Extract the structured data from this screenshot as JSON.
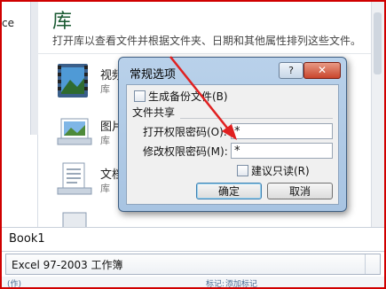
{
  "left_pane": {
    "cut_text": "ce"
  },
  "library": {
    "title": "库",
    "subtitle": "打开库以查看文件并根据文件夹、日期和其他属性排列这些文件。",
    "items": [
      {
        "name": "视频",
        "type": "库",
        "icon": "video-library-icon"
      },
      {
        "name": "图片",
        "type": "库",
        "icon": "picture-library-icon"
      },
      {
        "name": "文档",
        "type": "库",
        "icon": "document-library-icon"
      }
    ]
  },
  "filename": {
    "value": "Book1"
  },
  "filetype": {
    "value": "Excel 97-2003 工作簿"
  },
  "statusbar": {
    "left": "(作)",
    "right_a": "标记:",
    "right_b": "添加标记"
  },
  "dialog": {
    "title": "常规选项",
    "help_label": "?",
    "close_label": "✕",
    "backup_label": "生成备份文件(B)",
    "backup_checked": false,
    "group_label": "文件共享",
    "open_pw_label": "打开权限密码(O):",
    "open_pw_value": "*",
    "modify_pw_label": "修改权限密码(M):",
    "modify_pw_value": "*",
    "readonly_label": "建议只读(R)",
    "readonly_checked": false,
    "ok_label": "确定",
    "cancel_label": "取消"
  },
  "colors": {
    "annotation": "#e02020",
    "dialog_frame": "#a8c4e2"
  }
}
